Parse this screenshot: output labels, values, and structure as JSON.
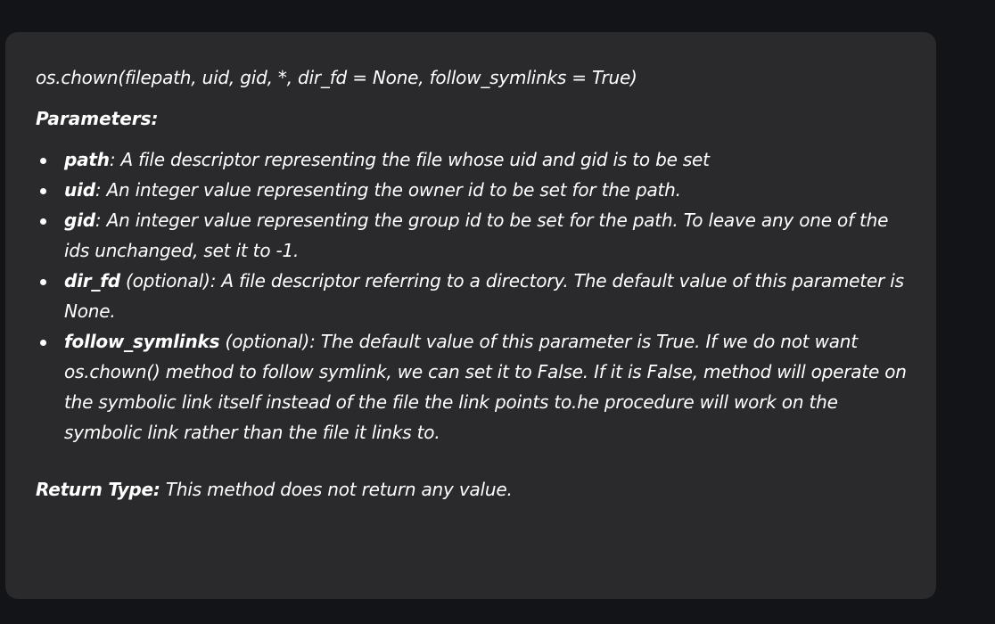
{
  "doc": {
    "signature": "os.chown(filepath, uid, gid, *, dir_fd = None, follow_symlinks = True)",
    "params_heading": "Parameters:",
    "params": [
      {
        "name": "path",
        "qualifier": "",
        "desc": ": A file descriptor representing the file whose uid and gid is to be set"
      },
      {
        "name": "uid",
        "qualifier": "",
        "desc": ": An integer value representing the owner id to be set for the path."
      },
      {
        "name": "gid",
        "qualifier": "",
        "desc": ": An integer value representing the group id to be set for the path. To leave any one of the ids unchanged, set it to -1."
      },
      {
        "name": "dir_fd",
        "qualifier": " (optional)",
        "desc": ": A file descriptor referring to a directory. The default value of this parameter is None."
      },
      {
        "name": "follow_symlinks",
        "qualifier": " (optional)",
        "desc": ": The default value of this parameter is True. If we do not want os.chown() method to follow symlink, we can set it to False. If it is False, method will operate on the symbolic link itself instead of the file the link points to.he procedure will work on the symbolic link rather than the file it links to."
      }
    ],
    "return_label": "Return Type:",
    "return_text": " This method does not return any value."
  }
}
